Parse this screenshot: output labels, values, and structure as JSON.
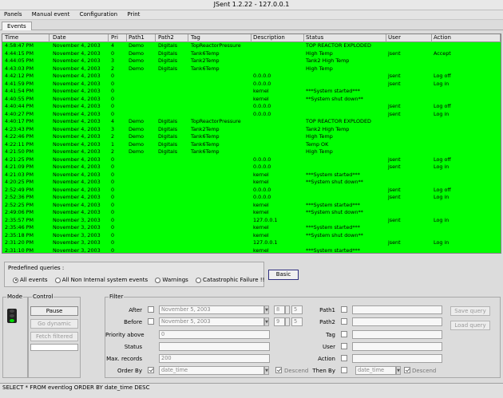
{
  "window": {
    "title": "JSent 1.2.22 - 127.0.0.1"
  },
  "menu": [
    "Panels",
    "Manual event",
    "Configuration",
    "Print"
  ],
  "tabs": [
    "Events"
  ],
  "grid": {
    "headers": [
      "Time",
      "Date",
      "Pri",
      "Path1",
      "Path2",
      "Tag",
      "Description",
      "Status",
      "User",
      "Action"
    ],
    "rows": [
      [
        "4:58:47 PM",
        "November 4, 2003",
        "4",
        "Demo",
        "Digitals",
        "TopReactorPressure",
        "",
        "TOP REACTOR EXPLODED",
        "",
        ""
      ],
      [
        "4:44:15 PM",
        "November 4, 2003",
        "0",
        "Demo",
        "Digitals",
        "Tank6Temp",
        "",
        "High Temp",
        "jsent",
        "Accept"
      ],
      [
        "4:44:05 PM",
        "November 4, 2003",
        "3",
        "Demo",
        "Digitals",
        "Tank2Temp",
        "",
        "Tank2 High Temp",
        "",
        ""
      ],
      [
        "4:43:03 PM",
        "November 4, 2003",
        "2",
        "Demo",
        "Digitals",
        "Tank6Temp",
        "",
        "High Temp",
        "",
        ""
      ],
      [
        "4:42:12 PM",
        "November 4, 2003",
        "0",
        "",
        "",
        "",
        "0.0.0.0",
        "",
        "jsent",
        "Log off"
      ],
      [
        "4:41:59 PM",
        "November 4, 2003",
        "0",
        "",
        "",
        "",
        "0.0.0.0",
        "",
        "jsent",
        "Log in"
      ],
      [
        "4:41:54 PM",
        "November 4, 2003",
        "0",
        "",
        "",
        "",
        "kernel",
        "***System started***",
        "",
        ""
      ],
      [
        "4:40:55 PM",
        "November 4, 2003",
        "0",
        "",
        "",
        "",
        "kernel",
        "**System shut down**",
        "",
        ""
      ],
      [
        "4:40:44 PM",
        "November 4, 2003",
        "0",
        "",
        "",
        "",
        "0.0.0.0",
        "",
        "jsent",
        "Log off"
      ],
      [
        "4:40:27 PM",
        "November 4, 2003",
        "0",
        "",
        "",
        "",
        "0.0.0.0",
        "",
        "jsent",
        "Log in"
      ],
      [
        "4:40:17 PM",
        "November 4, 2003",
        "4",
        "Demo",
        "Digitals",
        "TopReactorPressure",
        "",
        "TOP REACTOR EXPLODED",
        "",
        ""
      ],
      [
        "4:23:43 PM",
        "November 4, 2003",
        "3",
        "Demo",
        "Digitals",
        "Tank2Temp",
        "",
        "Tank2 High Temp",
        "",
        ""
      ],
      [
        "4:22:46 PM",
        "November 4, 2003",
        "2",
        "Demo",
        "Digitals",
        "Tank6Temp",
        "",
        "High Temp",
        "",
        ""
      ],
      [
        "4:22:11 PM",
        "November 4, 2003",
        "1",
        "Demo",
        "Digitals",
        "Tank6Temp",
        "",
        "Temp OK",
        "",
        ""
      ],
      [
        "4:21:50 PM",
        "November 4, 2003",
        "2",
        "Demo",
        "Digitals",
        "Tank6Temp",
        "",
        "High Temp",
        "",
        ""
      ],
      [
        "4:21:25 PM",
        "November 4, 2003",
        "0",
        "",
        "",
        "",
        "0.0.0.0",
        "",
        "jsent",
        "Log off"
      ],
      [
        "4:21:09 PM",
        "November 4, 2003",
        "0",
        "",
        "",
        "",
        "0.0.0.0",
        "",
        "jsent",
        "Log in"
      ],
      [
        "4:21:03 PM",
        "November 4, 2003",
        "0",
        "",
        "",
        "",
        "kernel",
        "***System started***",
        "",
        ""
      ],
      [
        "4:20:25 PM",
        "November 4, 2003",
        "0",
        "",
        "",
        "",
        "kernel",
        "**System shut down**",
        "",
        ""
      ],
      [
        "2:52:49 PM",
        "November 4, 2003",
        "0",
        "",
        "",
        "",
        "0.0.0.0",
        "",
        "jsent",
        "Log off"
      ],
      [
        "2:52:36 PM",
        "November 4, 2003",
        "0",
        "",
        "",
        "",
        "0.0.0.0",
        "",
        "jsent",
        "Log in"
      ],
      [
        "2:52:25 PM",
        "November 4, 2003",
        "0",
        "",
        "",
        "",
        "kernel",
        "***System started***",
        "",
        ""
      ],
      [
        "2:49:06 PM",
        "November 4, 2003",
        "0",
        "",
        "",
        "",
        "kernel",
        "**System shut down**",
        "",
        ""
      ],
      [
        "2:35:57 PM",
        "November 3, 2003",
        "0",
        "",
        "",
        "",
        "127.0.0.1",
        "",
        "jsent",
        "Log in"
      ],
      [
        "2:35:46 PM",
        "November 3, 2003",
        "0",
        "",
        "",
        "",
        "kernel",
        "***System started***",
        "",
        ""
      ],
      [
        "2:35:18 PM",
        "November 3, 2003",
        "0",
        "",
        "",
        "",
        "kernel",
        "**System shut down**",
        "",
        ""
      ],
      [
        "2:31:20 PM",
        "November 3, 2003",
        "0",
        "",
        "",
        "",
        "127.0.0.1",
        "",
        "jsent",
        "Log in"
      ],
      [
        "2:31:10 PM",
        "November 3, 2003",
        "0",
        "",
        "",
        "",
        "kernel",
        "***System started***",
        "",
        ""
      ]
    ]
  },
  "queries": {
    "label": "Predefined queries :",
    "options": [
      "All events",
      "All Non Internal system events",
      "Warnings",
      "Catastrophic Failure !!"
    ],
    "selected_index": 0,
    "basic_button": "Basic"
  },
  "mode": {
    "label": "Mode"
  },
  "control": {
    "label": "Control",
    "pause": "Pause",
    "go_dynamic": "Go dynamic",
    "fetch_filtered": "Fetch filtered"
  },
  "filter": {
    "label": "Filter",
    "after_label": "After",
    "after_date": "November 5, 2003",
    "after_hour": "8",
    "after_min": "5",
    "before_label": "Before",
    "before_date": "November 5, 2003",
    "before_hour": "9",
    "before_min": "5",
    "priority_label": "Priority above",
    "priority_value": "0",
    "status_label": "Status",
    "max_records_label": "Max. records",
    "max_records_value": "200",
    "order_by_label": "Order By",
    "order_by_value": "date_time",
    "descend_label": "Descend",
    "path1_label": "Path1",
    "path2_label": "Path2",
    "tag_label": "Tag",
    "user_label": "User",
    "action_label": "Action",
    "then_by_label": "Then By",
    "then_by_value": "date_time",
    "descend2_label": "Descend",
    "save_query": "Save query",
    "load_query": "Load query"
  },
  "status_bar": {
    "sql": "SELECT * FROM eventlog ORDER BY date_time DESC"
  },
  "colors": {
    "grid_bg": "#00ff00",
    "basic_button_border": "#303080"
  }
}
